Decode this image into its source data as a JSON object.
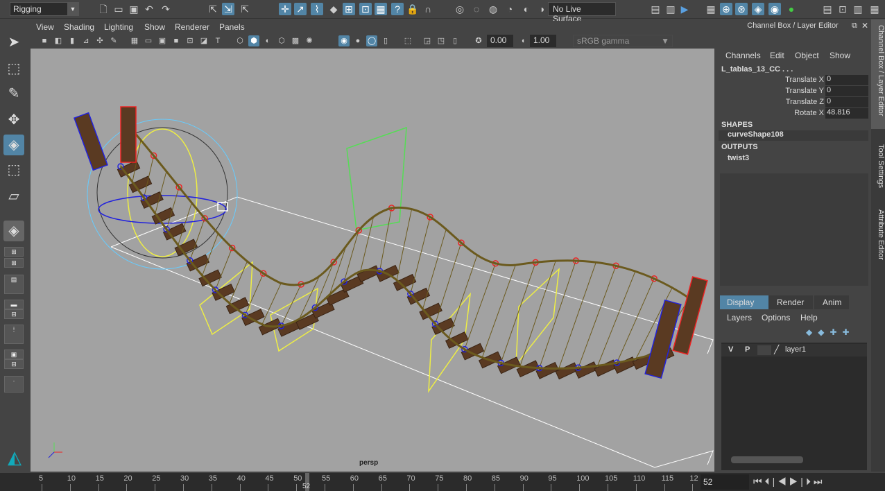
{
  "topbar": {
    "mode": "Rigging",
    "live_surface": "No Live Surface"
  },
  "viewport_panel": {
    "menus": [
      "View",
      "Shading",
      "Lighting",
      "Show",
      "Renderer",
      "Panels"
    ],
    "exposure": "0.00",
    "gamma": "1.00",
    "color_space": "sRGB gamma",
    "camera_label": "persp"
  },
  "right_panel": {
    "title": "Channel Box / Layer Editor",
    "menus": [
      "Channels",
      "Edit",
      "Object",
      "Show"
    ],
    "object_name": "L_tablas_13_CC . . .",
    "channels": [
      {
        "label": "Translate X",
        "value": "0"
      },
      {
        "label": "Translate Y",
        "value": "0"
      },
      {
        "label": "Translate Z",
        "value": "0"
      },
      {
        "label": "Rotate X",
        "value": "48.816"
      }
    ],
    "shapes_header": "SHAPES",
    "shape": "curveShape108",
    "outputs_header": "OUTPUTS",
    "output": "twist3",
    "layer_tabs": [
      "Display",
      "Render",
      "Anim"
    ],
    "layer_menus": [
      "Layers",
      "Options",
      "Help"
    ],
    "layer": {
      "v": "V",
      "p": "P",
      "name": "layer1"
    }
  },
  "side_tabs": [
    "Channel Box / Layer Editor",
    "Tool Settings",
    "Attribute Editor"
  ],
  "timeline": {
    "ticks": [
      "5",
      "10",
      "15",
      "20",
      "25",
      "30",
      "35",
      "40",
      "45",
      "50",
      "55",
      "60",
      "65",
      "70",
      "75",
      "80",
      "85",
      "90",
      "95",
      "100",
      "105",
      "110",
      "115",
      "12"
    ],
    "current_frame": "52",
    "frame_field": "52"
  },
  "colors": {
    "accent": "#5285a6",
    "viewport_bg": "#a2a2a2",
    "rope": "#6b5a1e",
    "plank": "#5a3a22"
  }
}
